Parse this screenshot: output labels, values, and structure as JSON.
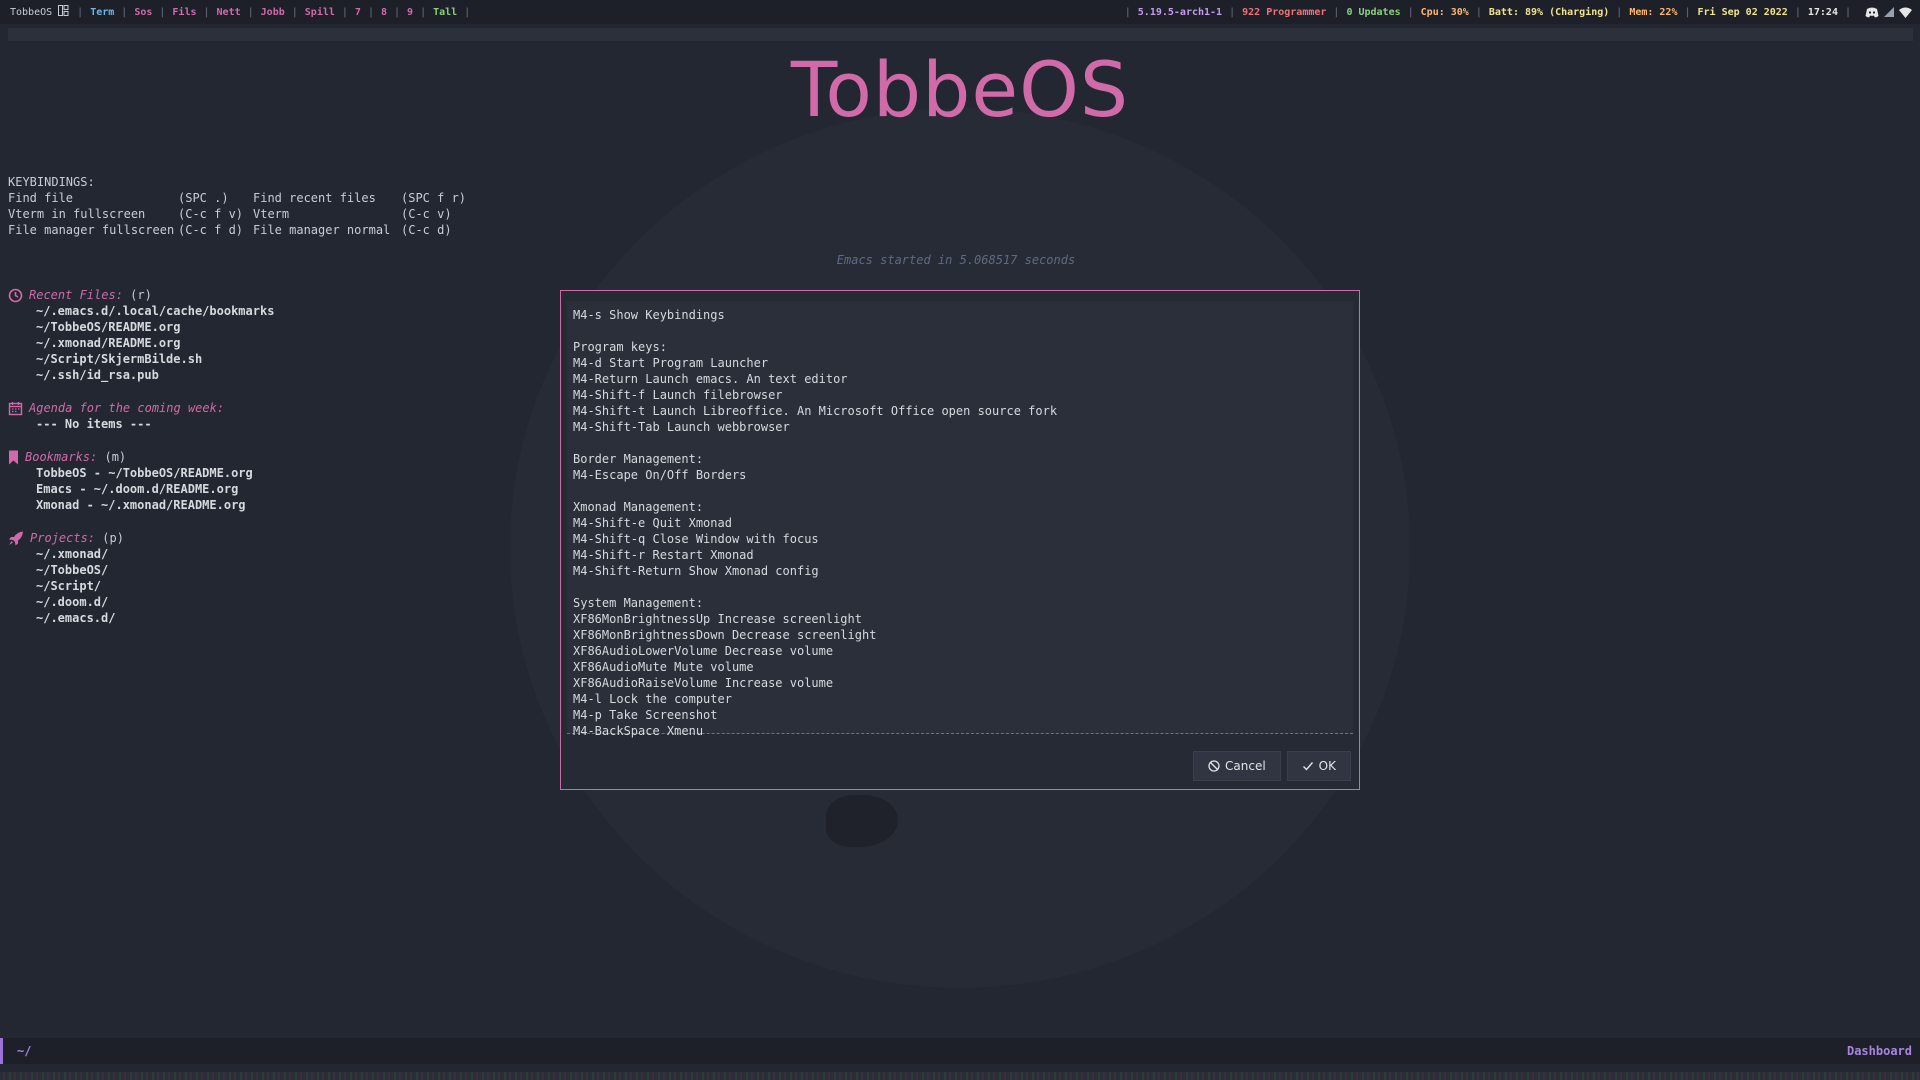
{
  "topbar": {
    "os_label": "TobbeOS",
    "workspaces": [
      {
        "label": "Term",
        "color": "#6fb6e8"
      },
      {
        "label": "Sos",
        "color": "#d16aa8"
      },
      {
        "label": "Fils",
        "color": "#d16aa8"
      },
      {
        "label": "Nett",
        "color": "#d16aa8"
      },
      {
        "label": "Jobb",
        "color": "#d16aa8"
      },
      {
        "label": "Spill",
        "color": "#d16aa8"
      },
      {
        "label": "7",
        "color": "#d16aa8"
      },
      {
        "label": "8",
        "color": "#d16aa8"
      },
      {
        "label": "9",
        "color": "#d16aa8"
      },
      {
        "label": "Tall",
        "color": "#8bd17c"
      }
    ],
    "stats": [
      {
        "label": "5.19.5-arch1-1",
        "color": "#c79bef"
      },
      {
        "label": "922 Programmer",
        "color": "#f07178"
      },
      {
        "label": "0 Updates",
        "color": "#8bd17c"
      },
      {
        "label": "Cpu: 30%",
        "color": "#ffb86c"
      },
      {
        "label": "Batt: 89% (Charging)",
        "color": "#f1e38c"
      },
      {
        "label": "Mem: 22%",
        "color": "#ffb86c"
      },
      {
        "label": "Fri Sep 02 2022",
        "color": "#f1e38c"
      },
      {
        "label": "17:24",
        "color": "#e6e6e6"
      }
    ],
    "tray_icons": [
      "discord-icon",
      "battery-icon",
      "wifi-icon"
    ]
  },
  "dashboard": {
    "title": "TobbeOS",
    "keybindings_header": "KEYBINDINGS:",
    "keybindings": [
      {
        "name": "Find file",
        "key": "(SPC .)",
        "name2": "Find recent files",
        "key2": "(SPC f r)"
      },
      {
        "name": "Vterm in fullscreen",
        "key": "(C-c f v)",
        "name2": "Vterm",
        "key2": "(C-c v)"
      },
      {
        "name": "File manager fullscreen",
        "key": "(C-c f d)",
        "name2": "File manager normal",
        "key2": "(C-c d)"
      }
    ],
    "startup_message": "Emacs started in 5.068517 seconds",
    "sections": {
      "recent": {
        "title": "Recent Files:",
        "key": "(r)",
        "items": [
          "~/.emacs.d/.local/cache/bookmarks",
          "~/TobbeOS/README.org",
          "~/.xmonad/README.org",
          "~/Script/SkjermBilde.sh",
          "~/.ssh/id_rsa.pub"
        ]
      },
      "agenda": {
        "title": "Agenda for the coming week:",
        "empty": "--- No items ---"
      },
      "bookmarks": {
        "title": "Bookmarks:",
        "key": "(m)",
        "items": [
          "TobbeOS - ~/TobbeOS/README.org",
          "Emacs - ~/.doom.d/README.org",
          "Xmonad - ~/.xmonad/README.org"
        ]
      },
      "projects": {
        "title": "Projects:",
        "key": "(p)",
        "items": [
          "~/.xmonad/",
          "~/TobbeOS/",
          "~/Script/",
          "~/.doom.d/",
          "~/.emacs.d/"
        ]
      }
    }
  },
  "dialog": {
    "lines": [
      "M4-s Show Keybindings",
      "",
      "Program keys:",
      "M4-d Start Program Launcher",
      "M4-Return Launch emacs. An text editor",
      "M4-Shift-f Launch filebrowser",
      "M4-Shift-t Launch Libreoffice. An Microsoft Office open source fork",
      "M4-Shift-Tab Launch webbrowser",
      "",
      "Border Management:",
      "M4-Escape On/Off Borders",
      "",
      "Xmonad Management:",
      "M4-Shift-e Quit Xmonad",
      "M4-Shift-q Close Window with focus",
      "M4-Shift-r Restart Xmonad",
      "M4-Shift-Return Show Xmonad config",
      "",
      "System Management:",
      "XF86MonBrightnessUp Increase screenlight",
      "XF86MonBrightnessDown Decrease screenlight",
      "XF86AudioLowerVolume Decrease volume",
      "XF86AudioMute Mute volume",
      "XF86AudioRaiseVolume Increase volume",
      "M4-l Lock the computer",
      "M4-p Take Screenshot",
      "M4-BackSpace Xmenu"
    ],
    "cancel_label": "Cancel",
    "ok_label": "OK"
  },
  "modeline": {
    "path": "~/",
    "mode": "Dashboard"
  },
  "colors": {
    "accent": "#d16aa8",
    "modeline_accent": "#a884e0",
    "background": "#232731"
  }
}
